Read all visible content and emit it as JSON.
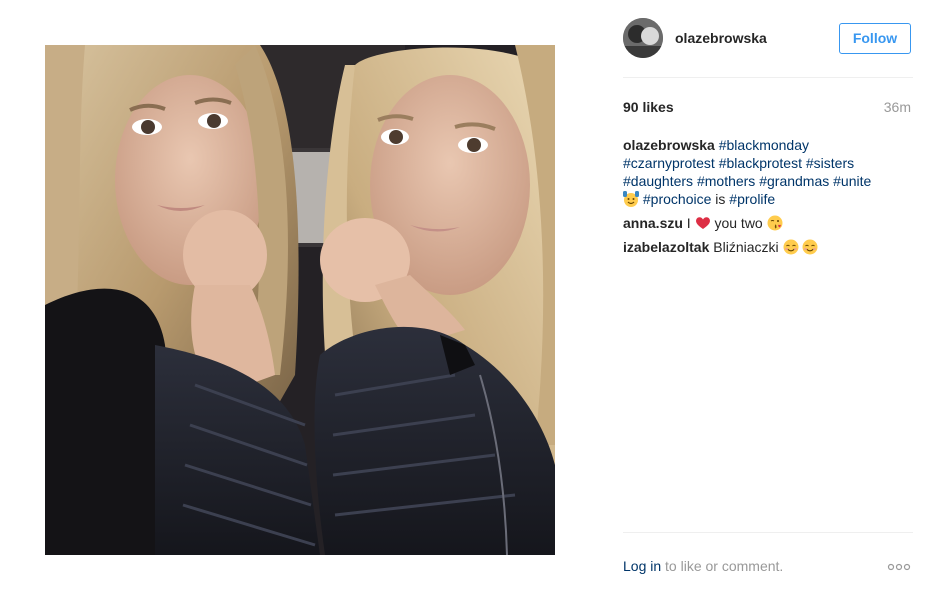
{
  "post": {
    "username": "olazebrowska",
    "follow_label": "Follow",
    "likes": "90 likes",
    "time_ago": "36m",
    "caption": {
      "username": "olazebrowska",
      "tags_line1": [
        "#blackmonday"
      ],
      "tags_line2": [
        "#czarnyprotest",
        "#blackprotest",
        "#sisters"
      ],
      "tags_line3": [
        "#daughters",
        "#mothers",
        "#grandmas",
        "#unite"
      ],
      "tag_prochoice": "#prochoice",
      "word_is": "is",
      "tag_prolife": "#prolife",
      "emoji": "raising-hands-emoji"
    },
    "comments": [
      {
        "username": "anna.szu",
        "text_before": "I",
        "text_after": "you two",
        "emojis": [
          "heart-icon",
          "kissing-face-emoji"
        ]
      },
      {
        "username": "izabelazoltak",
        "text": "Bliźniaczki",
        "emojis": [
          "smiling-face-emoji",
          "smiling-face-emoji"
        ]
      }
    ],
    "footer": {
      "login_label": "Log in",
      "rest_label": "to like or comment.",
      "more_icon": "more-options-icon"
    },
    "colors": {
      "accent": "#3897f0",
      "hashtag": "#003569",
      "muted": "#999999",
      "text": "#262626",
      "divider": "#efefef"
    }
  }
}
